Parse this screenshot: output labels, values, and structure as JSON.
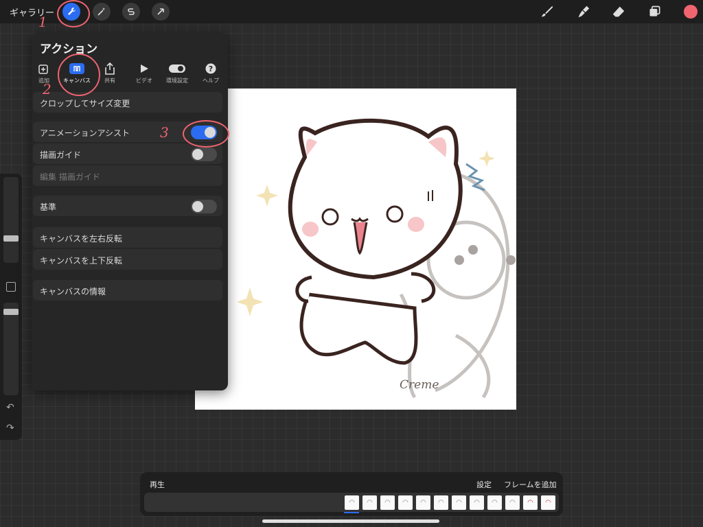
{
  "topbar": {
    "gallery_label": "ギャラリー",
    "tools_left": [
      "wrench-icon",
      "magic-wand-icon",
      "selection-s-icon",
      "transform-arrow-icon"
    ],
    "tools_right": [
      "brush-icon",
      "smudge-icon",
      "eraser-icon",
      "layers-icon"
    ],
    "color_swatch": "#f06470"
  },
  "panel": {
    "title": "アクション",
    "tabs": [
      {
        "label": "追加",
        "icon": "add-icon"
      },
      {
        "label": "キャンバス",
        "icon": "canvas-icon",
        "selected": true
      },
      {
        "label": "共有",
        "icon": "share-icon"
      },
      {
        "label": "ビデオ",
        "icon": "play-icon"
      },
      {
        "label": "環境設定",
        "icon": "toggle-icon"
      },
      {
        "label": "ヘルプ",
        "icon": "help-icon"
      }
    ],
    "rows": {
      "crop": "クロップしてサイズ変更",
      "animation_assist": "アニメーションアシスト",
      "drawing_guide": "描画ガイド",
      "edit_guide": "編集 描画ガイド",
      "reference": "基準",
      "flip_h": "キャンバスを左右反転",
      "flip_v": "キャンバスを上下反転",
      "canvas_info": "キャンバスの情報"
    },
    "toggles": {
      "animation_assist": true,
      "drawing_guide": false,
      "reference": false
    }
  },
  "canvas": {
    "signature": "Creme"
  },
  "timeline": {
    "play": "再生",
    "settings": "設定",
    "add_frame": "フレームを追加",
    "frame_count": 12
  },
  "annotations": [
    "1",
    "2",
    "3"
  ],
  "colors": {
    "accent": "#2b6cf0",
    "annotation": "#f06470"
  }
}
